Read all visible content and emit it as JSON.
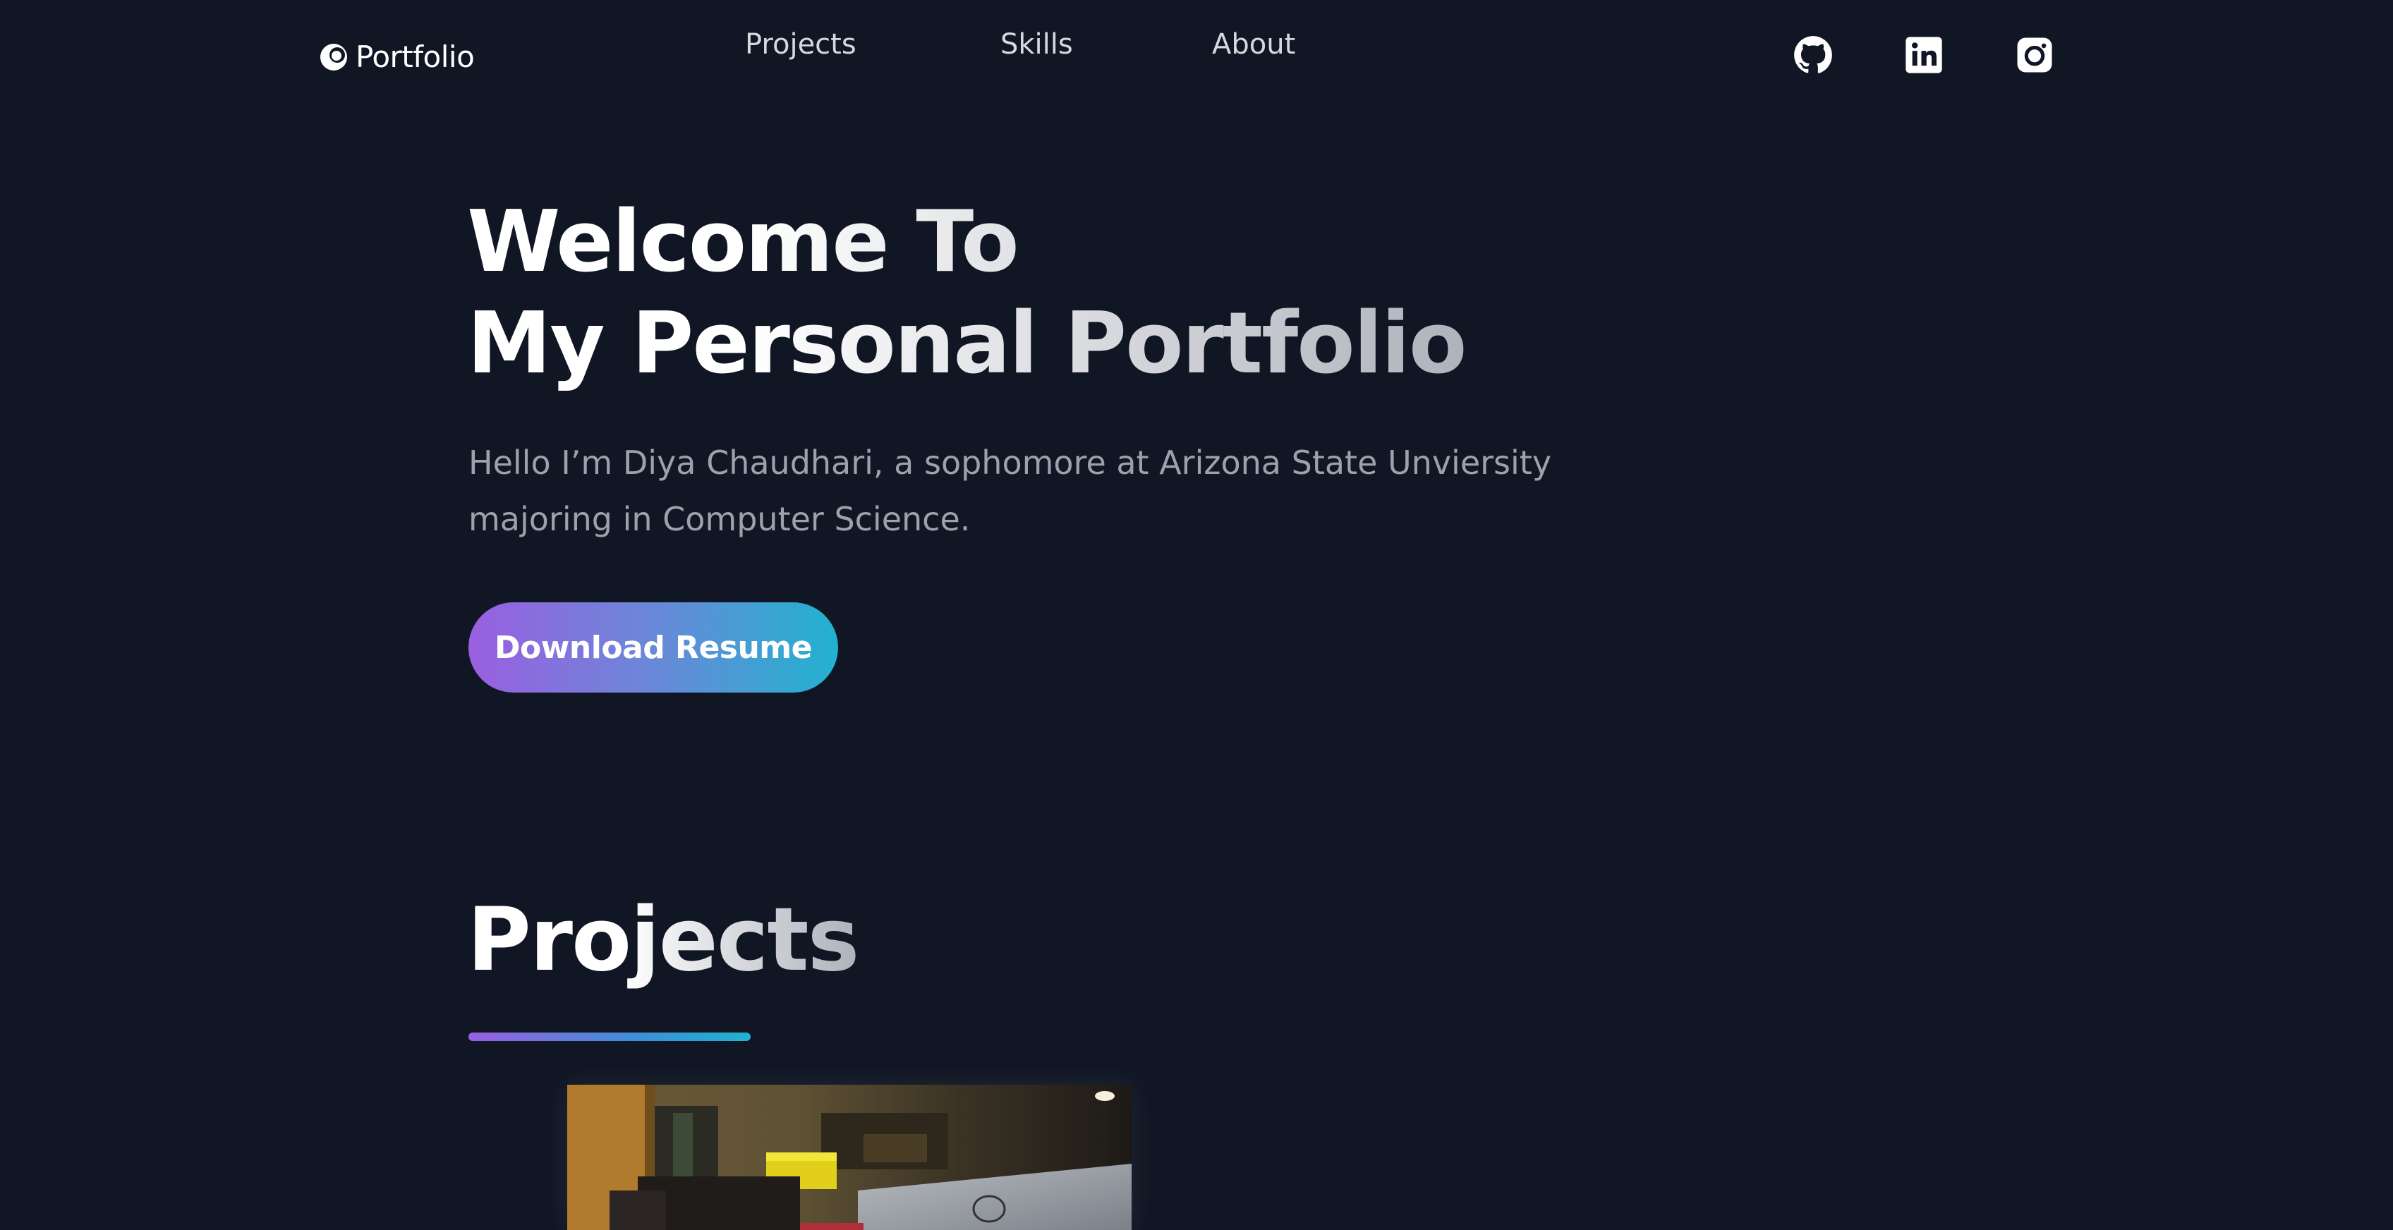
{
  "nav": {
    "logo_text": "Portfolio",
    "links": [
      "Projects",
      "Skills",
      "About"
    ],
    "social_icons": [
      "github-icon",
      "linkedin-icon",
      "instagram-icon"
    ]
  },
  "hero": {
    "title_line1": "Welcome To",
    "title_line2": "My Personal Portfolio",
    "subtitle": "Hello I’m Diya Chaudhari, a sophomore at Arizona State Unviersity majoring in Computer Science.",
    "button_label": "Download Resume"
  },
  "projects": {
    "title": "Projects"
  },
  "colors": {
    "background": "#101623",
    "accent_purple": "#9a5fe0",
    "accent_cyan": "#21b2cf",
    "muted_text": "#9ca2ad"
  }
}
